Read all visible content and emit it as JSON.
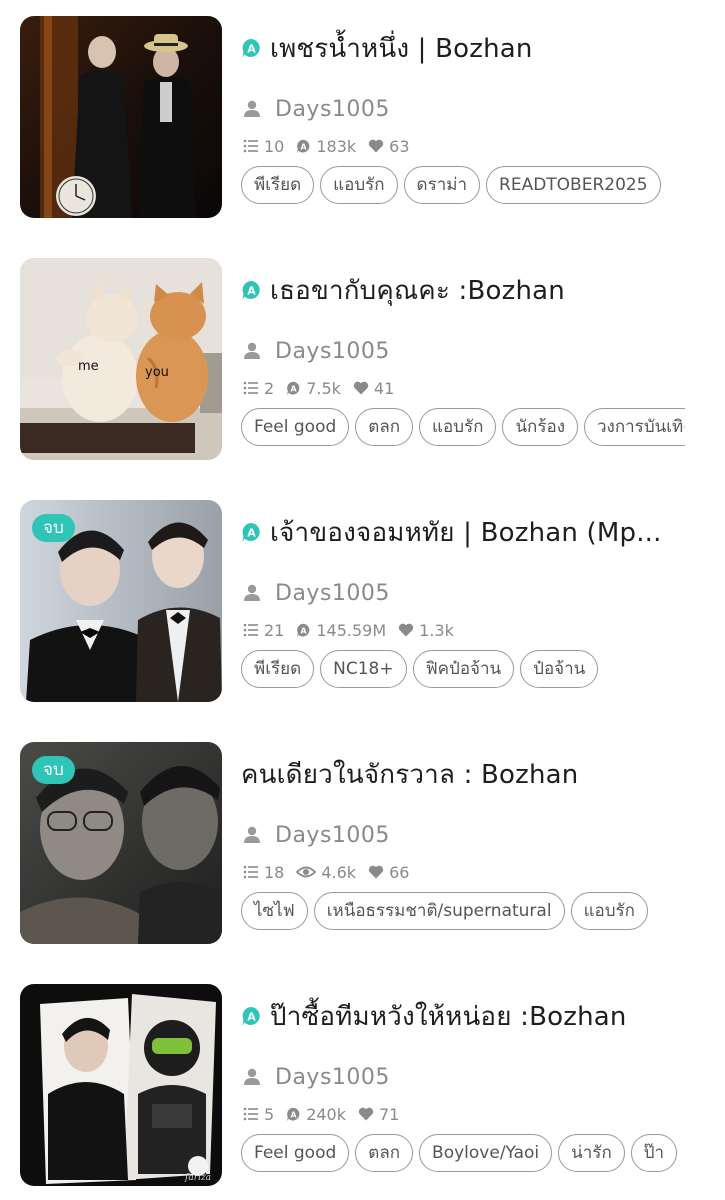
{
  "stories": [
    {
      "title": "เพชรน้ำหนึ่ง | Bozhan",
      "has_badge": true,
      "completed": false,
      "author": "Days1005",
      "stats": {
        "chapters": "10",
        "reads": "183k",
        "reads_icon": "badge-a-icon",
        "likes": "63"
      },
      "tags": [
        "พีเรียด",
        "แอบรัก",
        "ดราม่า",
        "READTOBER2025"
      ]
    },
    {
      "title": "เธอขากับคุณคะ :Bozhan",
      "has_badge": true,
      "completed": false,
      "author": "Days1005",
      "stats": {
        "chapters": "2",
        "reads": "7.5k",
        "reads_icon": "badge-a-icon",
        "likes": "41"
      },
      "tags": [
        "Feel good",
        "ตลก",
        "แอบรัก",
        "นักร้อง",
        "วงการบันเทิง"
      ],
      "cover_text": {
        "left": "me",
        "right": "you"
      }
    },
    {
      "title": "เจ้าของจอมหทัย | Bozhan (Mp...",
      "has_badge": true,
      "completed": true,
      "completed_label": "จบ",
      "author": "Days1005",
      "stats": {
        "chapters": "21",
        "reads": "145.59M",
        "reads_icon": "badge-a-icon",
        "likes": "1.3k"
      },
      "tags": [
        "พีเรียด",
        "NC18+",
        "ฟิคป๋อจ้าน",
        "ป๋อจ้าน"
      ]
    },
    {
      "title": "คนเดียวในจักรวาล : Bozhan",
      "has_badge": false,
      "completed": true,
      "completed_label": "จบ",
      "author": "Days1005",
      "stats": {
        "chapters": "18",
        "reads": "4.6k",
        "reads_icon": "eye-icon",
        "likes": "66"
      },
      "tags": [
        "ไซไฟ",
        "เหนือธรรมชาติ/supernatural",
        "แอบรัก"
      ]
    },
    {
      "title": "ป๊าซื้อทีมหวังให้หน่อย :Bozhan",
      "has_badge": true,
      "completed": false,
      "author": "Days1005",
      "stats": {
        "chapters": "5",
        "reads": "240k",
        "reads_icon": "badge-a-icon",
        "likes": "71"
      },
      "tags": [
        "Feel good",
        "ตลก",
        "Boylove/Yaoi",
        "น่ารัก",
        "ป๊า"
      ],
      "cover_text": {
        "signature": "fariza"
      }
    }
  ],
  "colors": {
    "accent": "#2ec4b6",
    "muted": "#8a8a8a",
    "title": "#1e1e1e",
    "tag_border": "#9a9a9a"
  }
}
